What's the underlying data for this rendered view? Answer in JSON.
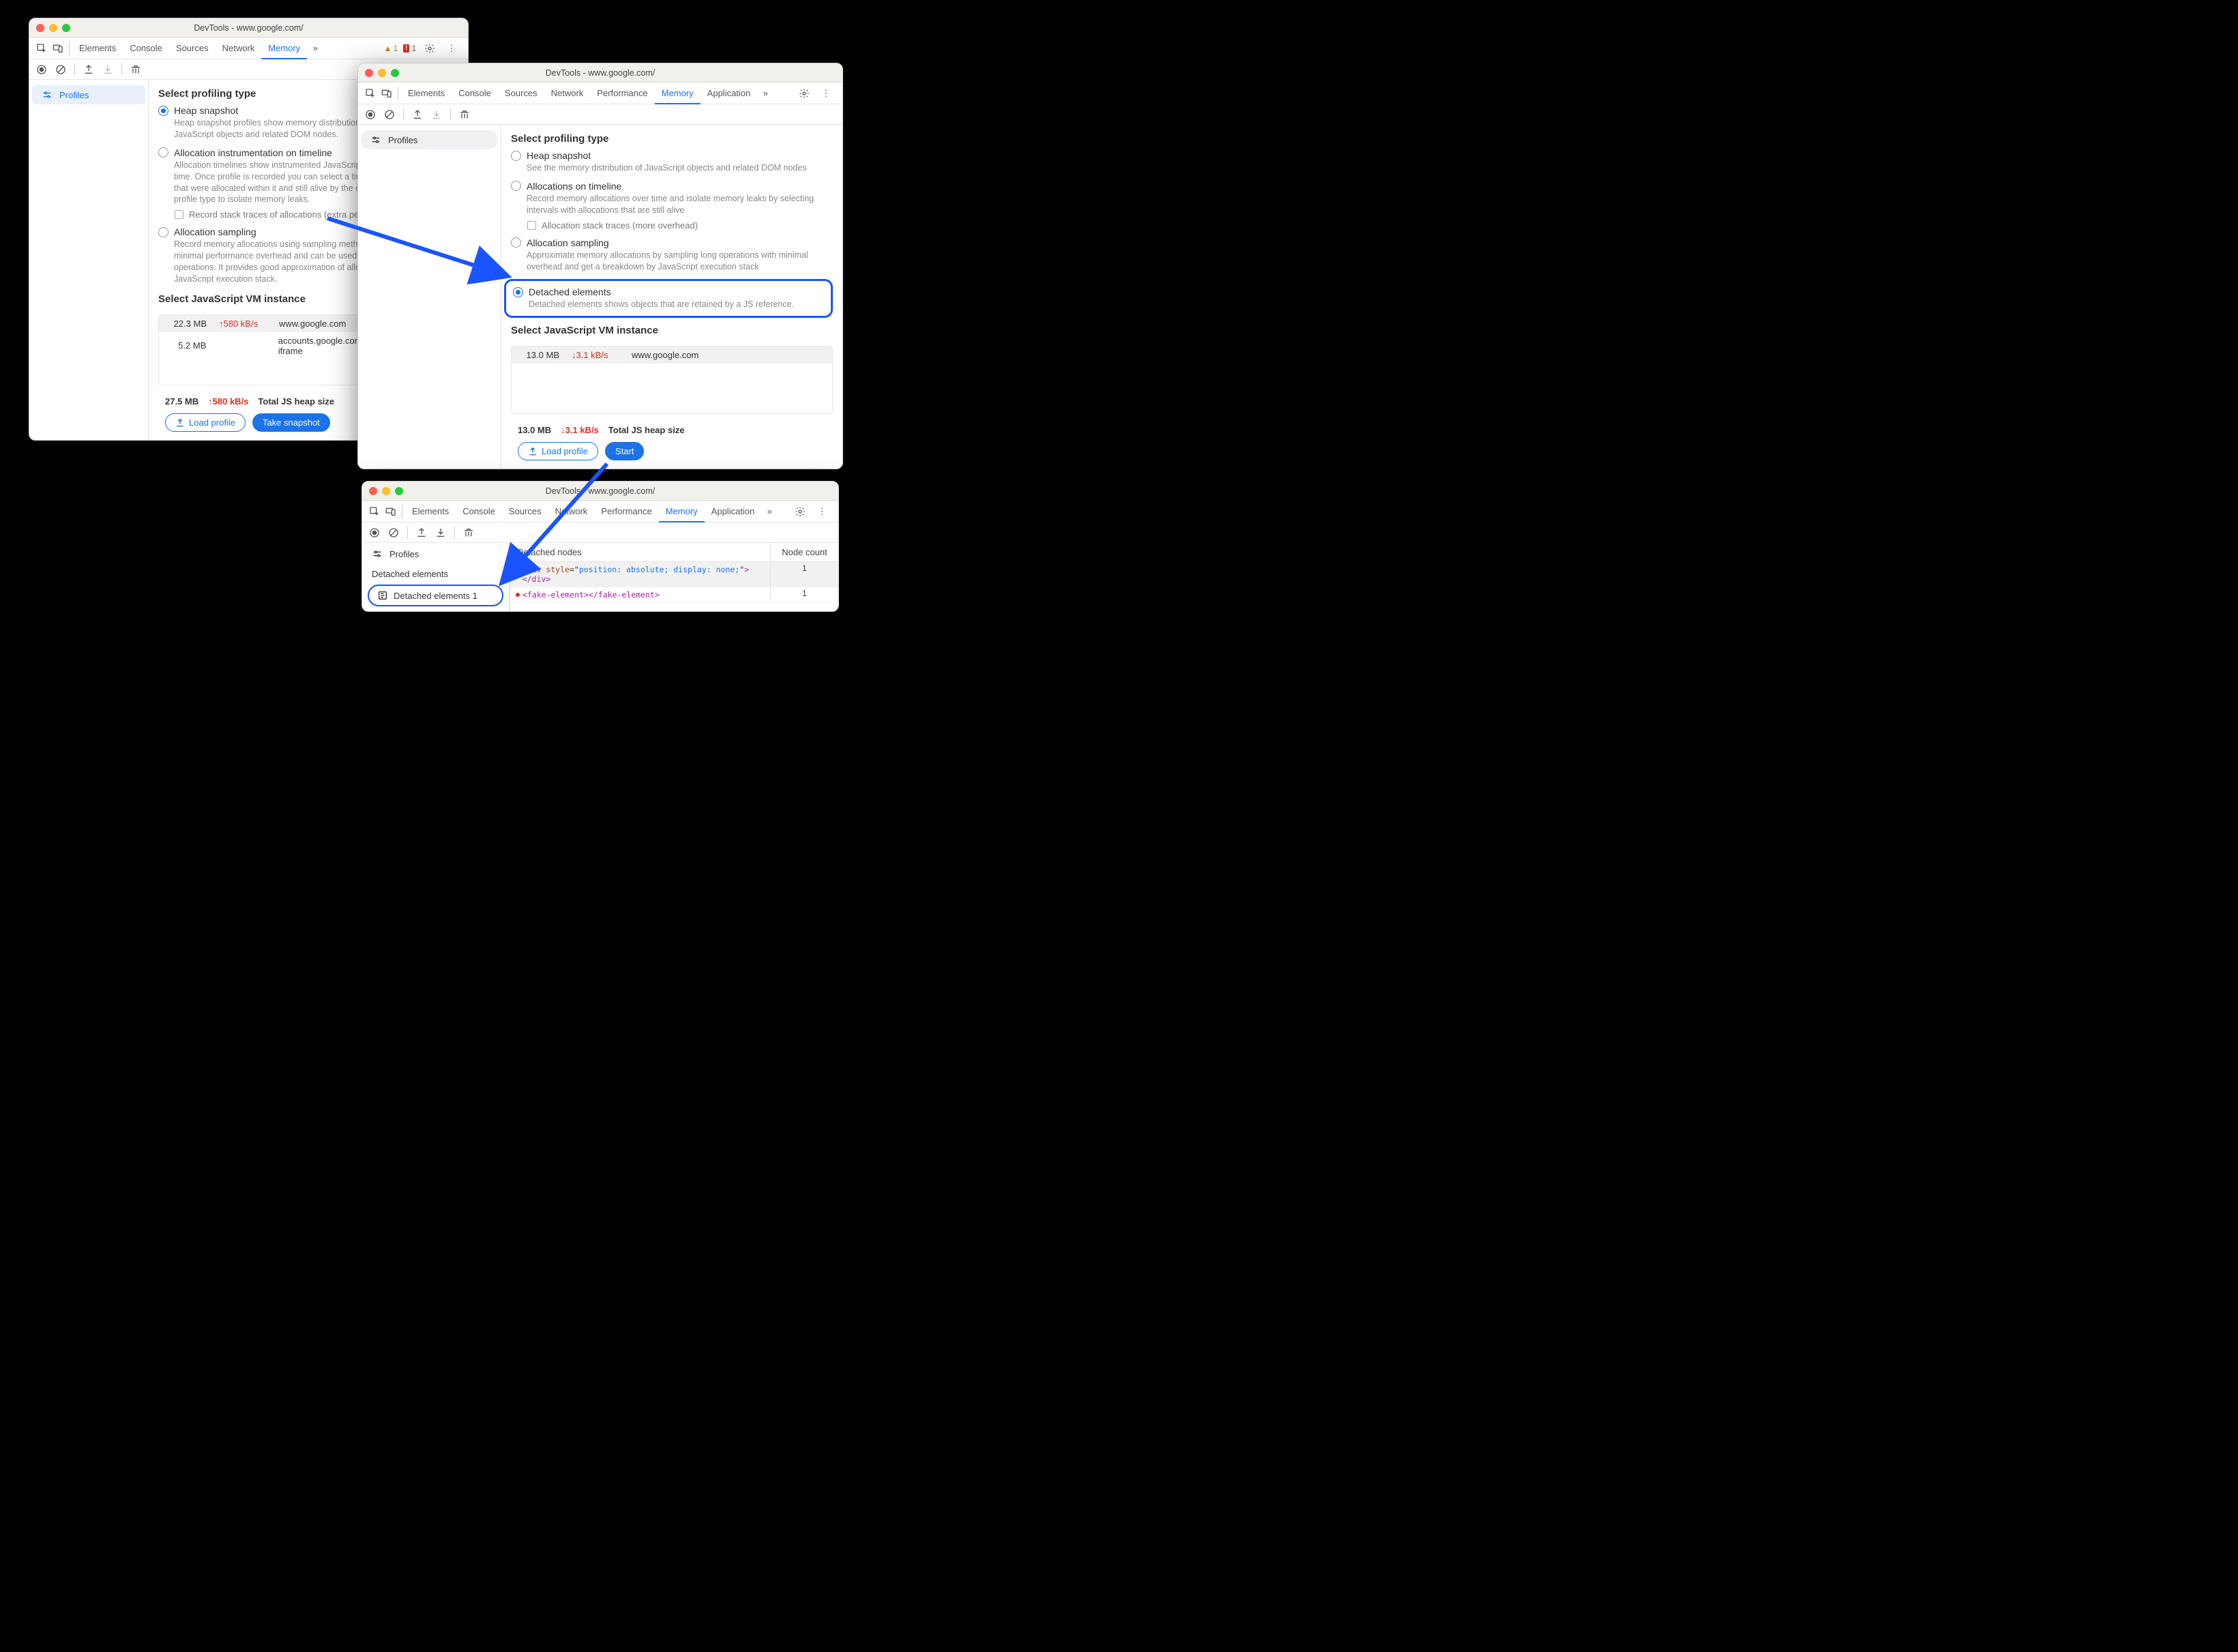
{
  "window1": {
    "title": "DevTools - www.google.com/",
    "tabs": [
      "Elements",
      "Console",
      "Sources",
      "Network",
      "Memory"
    ],
    "active_tab": "Memory",
    "warning_count": "1",
    "error_count": "1",
    "sidebar": {
      "profiles": "Profiles"
    },
    "heading": "Select profiling type",
    "options": {
      "heap": {
        "label": "Heap snapshot",
        "desc": "Heap snapshot profiles show memory distribution among your page's JavaScript objects and related DOM nodes."
      },
      "timeline": {
        "label": "Allocation instrumentation on timeline",
        "desc": "Allocation timelines show instrumented JavaScript memory allocations over time. Once profile is recorded you can select a time interval to see objects that were allocated within it and still alive by the end of recording. Use this profile type to isolate memory leaks.",
        "sub": "Record stack traces of allocations (extra performance overhead)"
      },
      "sampling": {
        "label": "Allocation sampling",
        "desc": "Record memory allocations using sampling method. This profile type has minimal performance overhead and can be used for long running operations. It provides good approximation of allocations broken down by JavaScript execution stack."
      }
    },
    "vm_heading": "Select JavaScript VM instance",
    "vm_rows": [
      {
        "size": "22.3 MB",
        "rate": "↑580 kB/s",
        "host": "www.google.com"
      },
      {
        "size": "5.2 MB",
        "rate": "",
        "host": "accounts.google.com: Rotate cookies iframe"
      }
    ],
    "footer": {
      "size": "27.5 MB",
      "rate": "↑580 kB/s",
      "label": "Total JS heap size",
      "load": "Load profile",
      "snap": "Take snapshot"
    }
  },
  "window2": {
    "title": "DevTools - www.google.com/",
    "tabs": [
      "Elements",
      "Console",
      "Sources",
      "Network",
      "Performance",
      "Memory",
      "Application"
    ],
    "active_tab": "Memory",
    "sidebar": {
      "profiles": "Profiles"
    },
    "heading": "Select profiling type",
    "options": {
      "heap": {
        "label": "Heap snapshot",
        "desc": "See the memory distribution of JavaScript objects and related DOM nodes"
      },
      "timeline": {
        "label": "Allocations on timeline",
        "desc": "Record memory allocations over time and isolate memory leaks by selecting intervals with allocations that are still alive",
        "sub": "Allocation stack traces (more overhead)"
      },
      "sampling": {
        "label": "Allocation sampling",
        "desc": "Approximate memory allocations by sampling long operations with minimal overhead and get a breakdown by JavaScript execution stack"
      },
      "detached": {
        "label": "Detached elements",
        "desc": "Detached elements shows objects that are retained by a JS reference."
      }
    },
    "vm_heading": "Select JavaScript VM instance",
    "vm_rows": [
      {
        "size": "13.0 MB",
        "rate": "↓3.1 kB/s",
        "host": "www.google.com"
      }
    ],
    "footer": {
      "size": "13.0 MB",
      "rate": "↓3.1 kB/s",
      "label": "Total JS heap size",
      "load": "Load profile",
      "start": "Start"
    }
  },
  "window3": {
    "title": "DevTools - www.google.com/",
    "tabs": [
      "Elements",
      "Console",
      "Sources",
      "Network",
      "Performance",
      "Memory",
      "Application"
    ],
    "active_tab": "Memory",
    "sidebar": {
      "profiles": "Profiles",
      "section": "Detached elements",
      "item": "Detached elements 1"
    },
    "columns": {
      "nodes": "Detached nodes",
      "count": "Node count"
    },
    "rows": [
      {
        "html": "<div style=\"position: absolute; display: none;\"></div>",
        "count": "1"
      },
      {
        "html": "<fake-element></fake-element>",
        "count": "1"
      }
    ]
  }
}
